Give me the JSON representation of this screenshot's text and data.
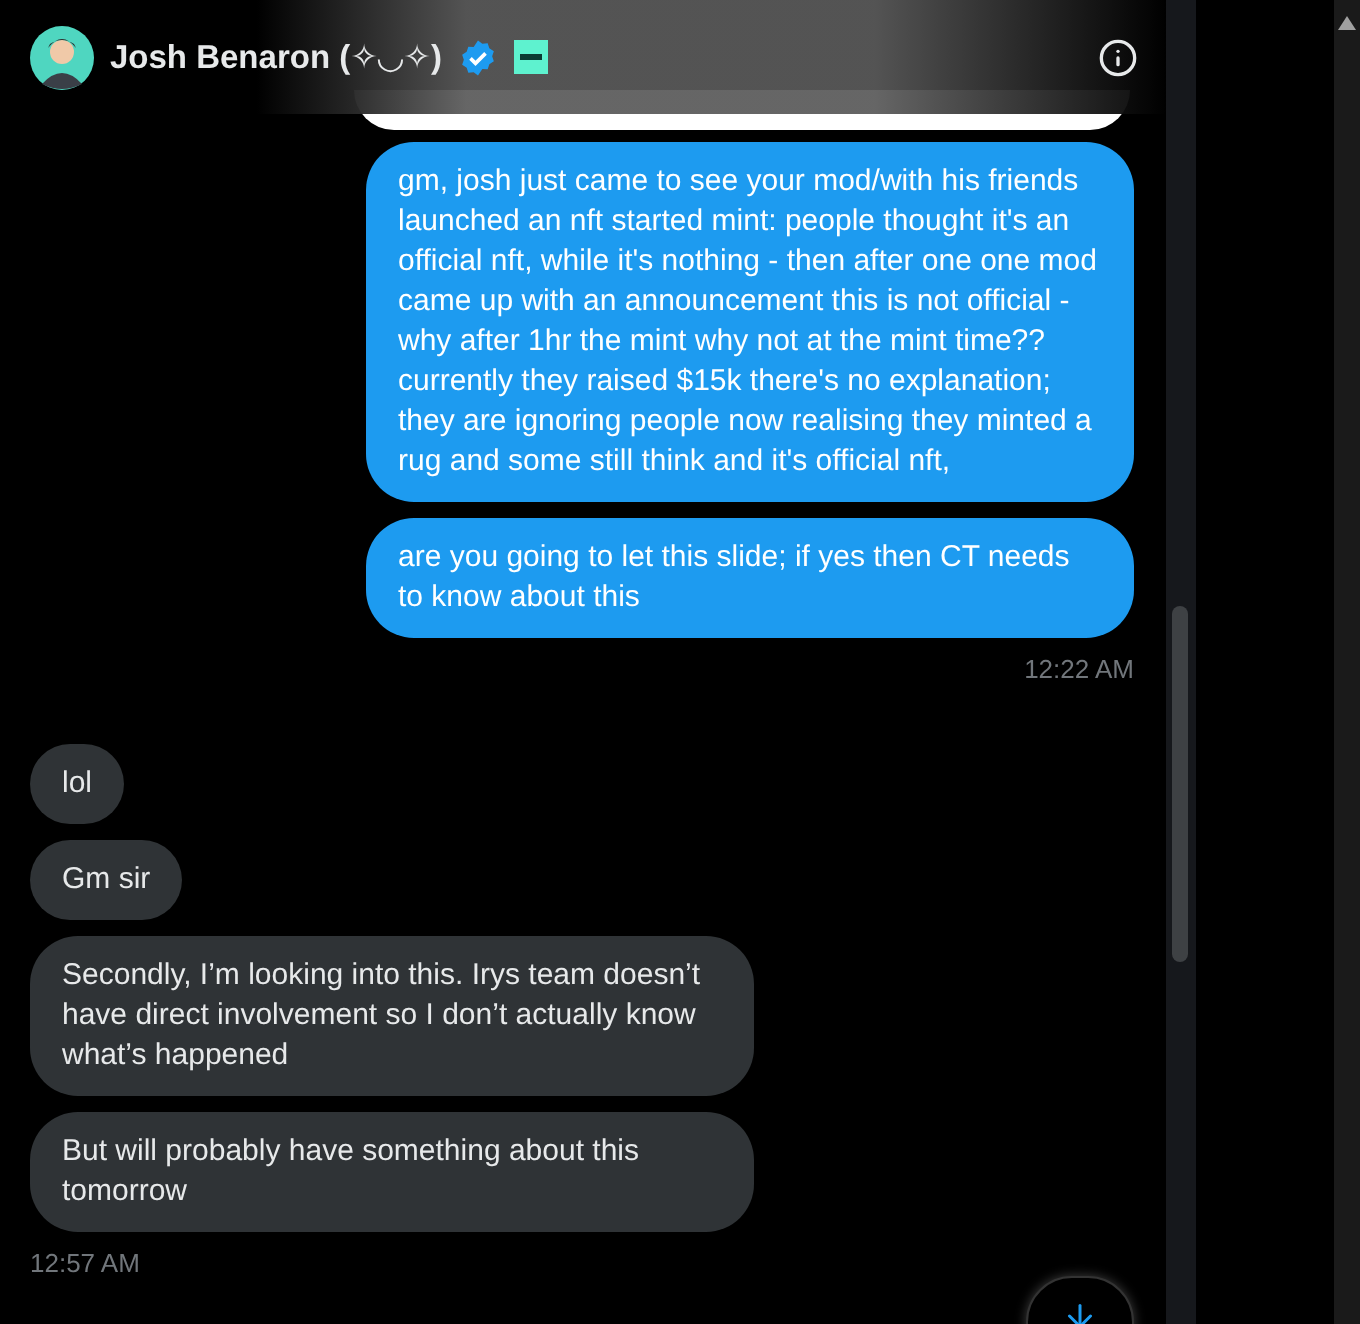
{
  "header": {
    "name": "Josh Benaron (✧◡✧)",
    "verified": true
  },
  "messages": [
    {
      "kind": "sent_partial"
    },
    {
      "kind": "sent",
      "text": "gm, josh just came to see your mod/with his friends launched an nft started mint: people thought it's an official nft, while it's nothing - then after one one mod came up with an announcement this is not official - why after 1hr the mint why not at the mint time??  currently they raised $15k there's no explanation; they are ignoring people now realising they minted a rug and some still think and it's official nft,"
    },
    {
      "kind": "sent",
      "text": "are you going to let this slide; if yes then CT needs to know about this"
    },
    {
      "kind": "sent_time",
      "text": "12:22 AM"
    },
    {
      "kind": "received",
      "text": "lol"
    },
    {
      "kind": "received",
      "text": "Gm sir"
    },
    {
      "kind": "received",
      "text": "Secondly, I’m looking into this. Irys team doesn’t have direct involvement so I don’t actually know what’s happened"
    },
    {
      "kind": "received",
      "text": "But will probably have something about this tomorrow"
    },
    {
      "kind": "received_time",
      "text": "12:57 AM"
    }
  ]
}
